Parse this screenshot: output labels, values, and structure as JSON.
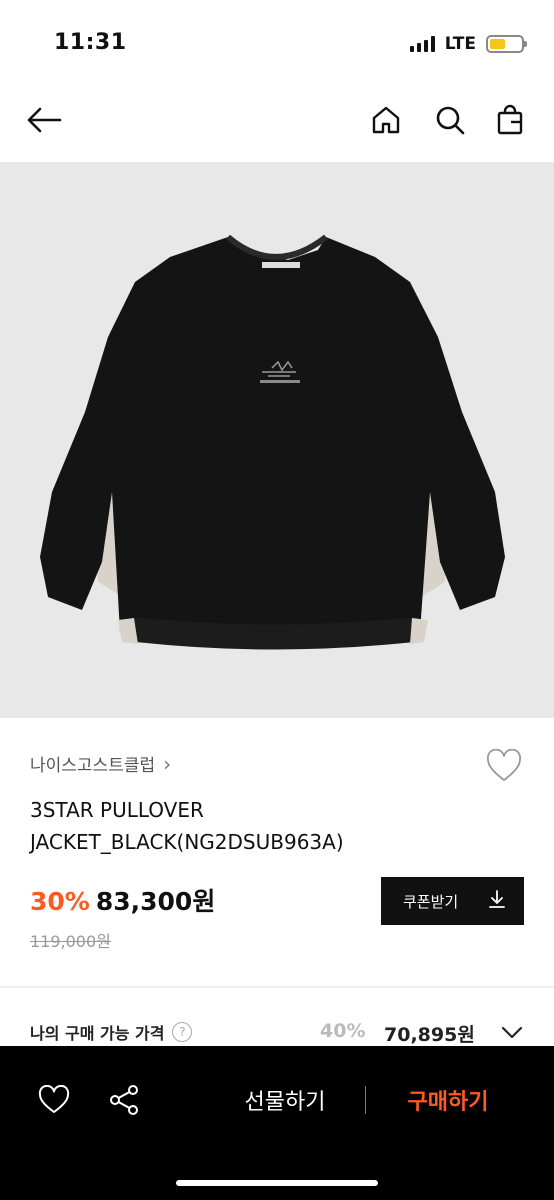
{
  "status": {
    "time": "11:31",
    "network": "LTE"
  },
  "nav": {
    "icons": [
      "back-arrow-icon",
      "home-icon",
      "search-icon",
      "shopping-bag-icon"
    ]
  },
  "product": {
    "brand": "나이스고스트클럽",
    "brand_chevron": "›",
    "name": "3STAR PULLOVER JACKET_BLACK(NG2DSUB963A)",
    "discount": "30%",
    "sale_price": "83,300원",
    "original_price": "119,000원",
    "coupon_label": "쿠폰받기",
    "image_colors": {
      "background": "#e8e8e8",
      "body": "#141414",
      "side_panel": "#d8d2c8"
    }
  },
  "my_price": {
    "label": "나의 구매 가능 가격",
    "help": "?",
    "discount": "40%",
    "price": "70,895원"
  },
  "bottom_bar": {
    "gift_label": "선물하기",
    "buy_label": "구매하기",
    "accent_color": "#ff5a1f"
  }
}
